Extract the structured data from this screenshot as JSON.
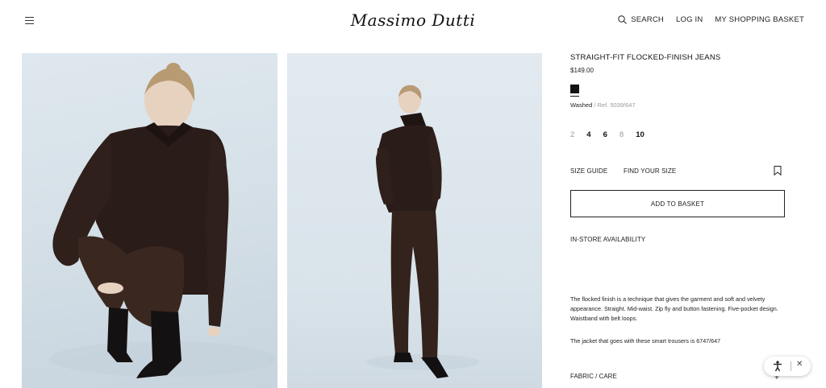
{
  "header": {
    "brand": "Massimo Dutti",
    "nav": {
      "search": "SEARCH",
      "login": "LOG IN",
      "basket": "MY SHOPPING BASKET"
    }
  },
  "product": {
    "title": "STRAIGHT-FIT FLOCKED-FINISH JEANS",
    "price": "$149.00",
    "swatch_color": "#141212",
    "color_name": "Washed",
    "ref": " / Ref. 5039/647",
    "sizes": [
      {
        "label": "2",
        "available": false
      },
      {
        "label": "4",
        "available": true
      },
      {
        "label": "6",
        "available": true
      },
      {
        "label": "8",
        "available": false
      },
      {
        "label": "10",
        "available": true
      }
    ],
    "size_guide": "SIZE GUIDE",
    "find_size": "FIND YOUR SIZE",
    "add_to_basket": "ADD TO BASKET",
    "in_store": "IN-STORE AVAILABILITY",
    "description": "The flocked finish is a technique that gives the garment and soft and velvety appearance. Straight. Mid-waist. Zip fly and button fastening. Five-pocket design. Waistband with belt loops.",
    "jacket_note": "The jacket that goes with these smart trousers is 6747/647",
    "fabric_care": "FABRIC / CARE",
    "fabric_toggle": "+"
  },
  "accessibility_widget": {
    "close": "✕"
  },
  "colors": {
    "accent": "#111111",
    "muted": "#9a9a9a",
    "background": "#ffffff"
  }
}
